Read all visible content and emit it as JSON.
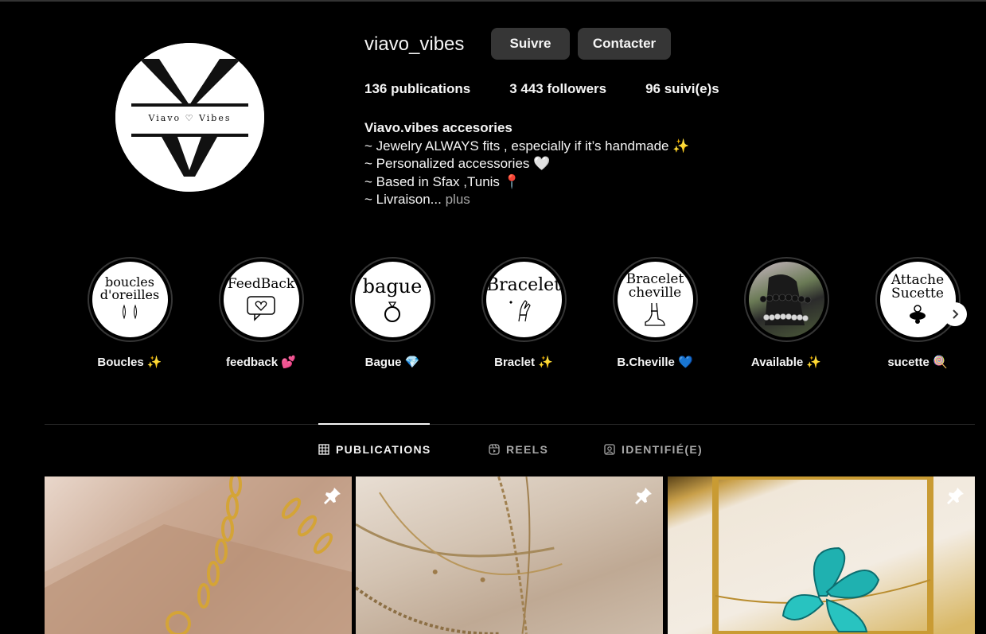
{
  "profile": {
    "username": "viavo_vibes",
    "follow_label": "Suivre",
    "contact_label": "Contacter",
    "logo_text": "Viavo ♡ Vibes"
  },
  "stats": {
    "publications": "136 publications",
    "followers": "3 443 followers",
    "following": "96 suivi(e)s"
  },
  "bio": {
    "name": "Viavo.vibes accesories",
    "line1": "~ Jewelry ALWAYS fits , especially if it’s handmade ✨",
    "line2": "~ Personalized accessories 🤍",
    "line3": "~ Based in Sfax ,Tunis 📍",
    "line4": "~ Livraison...",
    "more": "plus"
  },
  "highlights": [
    {
      "cover": "boucles d'oreilles",
      "label": "Boucles ✨",
      "icon": "earrings-icon"
    },
    {
      "cover": "FeedBack",
      "label": "feedback 💕",
      "icon": "chat-heart-icon"
    },
    {
      "cover": "bague",
      "label": "Bague 💎",
      "icon": "ring-icon"
    },
    {
      "cover": "Bracelet",
      "label": "Braclet ✨",
      "icon": "hand-bracelet-icon"
    },
    {
      "cover": "Bracelet cheville",
      "label": "B.Cheville 💙",
      "icon": "ankle-icon"
    },
    {
      "cover": "",
      "label": "Available ✨",
      "icon": "bracelet-photo"
    },
    {
      "cover": "Attache Sucette",
      "label": "sucette 🍭",
      "icon": "pacifier-icon"
    }
  ],
  "tabs": {
    "publications": "PUBLICATIONS",
    "reels": "REELS",
    "tagged": "IDENTIFIÉ(E)"
  },
  "colors": {
    "background": "#000000",
    "button": "#363636",
    "text": "#f5f5f5",
    "muted": "#a8a8a8"
  }
}
